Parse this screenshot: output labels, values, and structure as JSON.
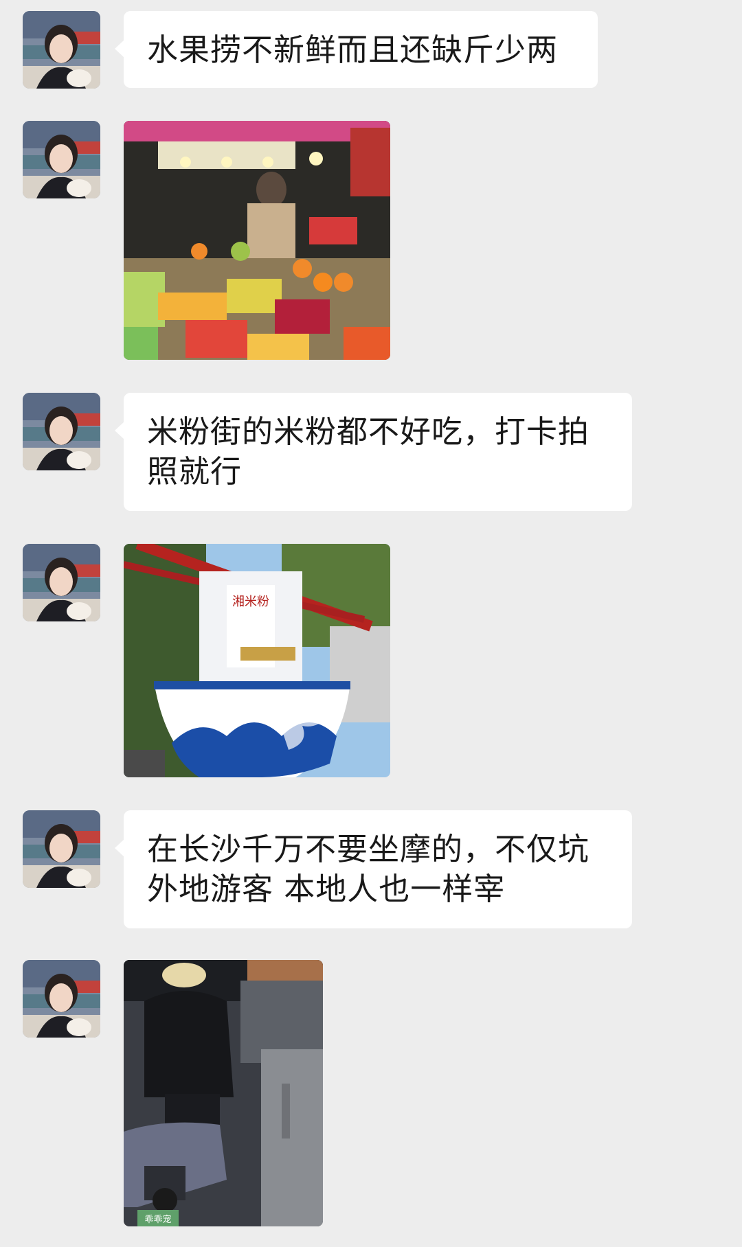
{
  "messages": [
    {
      "kind": "text",
      "text": "水果捞不新鲜而且还缺斤少两"
    },
    {
      "kind": "image",
      "image_subject": "fruit-stall-photo"
    },
    {
      "kind": "text",
      "text": "米粉街的米粉都不好吃，打卡拍照就行"
    },
    {
      "kind": "image",
      "image_subject": "noodle-bowl-sculpture-photo",
      "sign_text": "湘米粉"
    },
    {
      "kind": "text",
      "text": "在长沙千万不要坐摩的，不仅坑外地游客 本地人也一样宰"
    },
    {
      "kind": "image",
      "image_subject": "motorcycle-taxi-photo",
      "plate_text": "乖乖宠"
    }
  ],
  "colors": {
    "background": "#ededed",
    "bubble": "#ffffff",
    "text": "#191919"
  }
}
